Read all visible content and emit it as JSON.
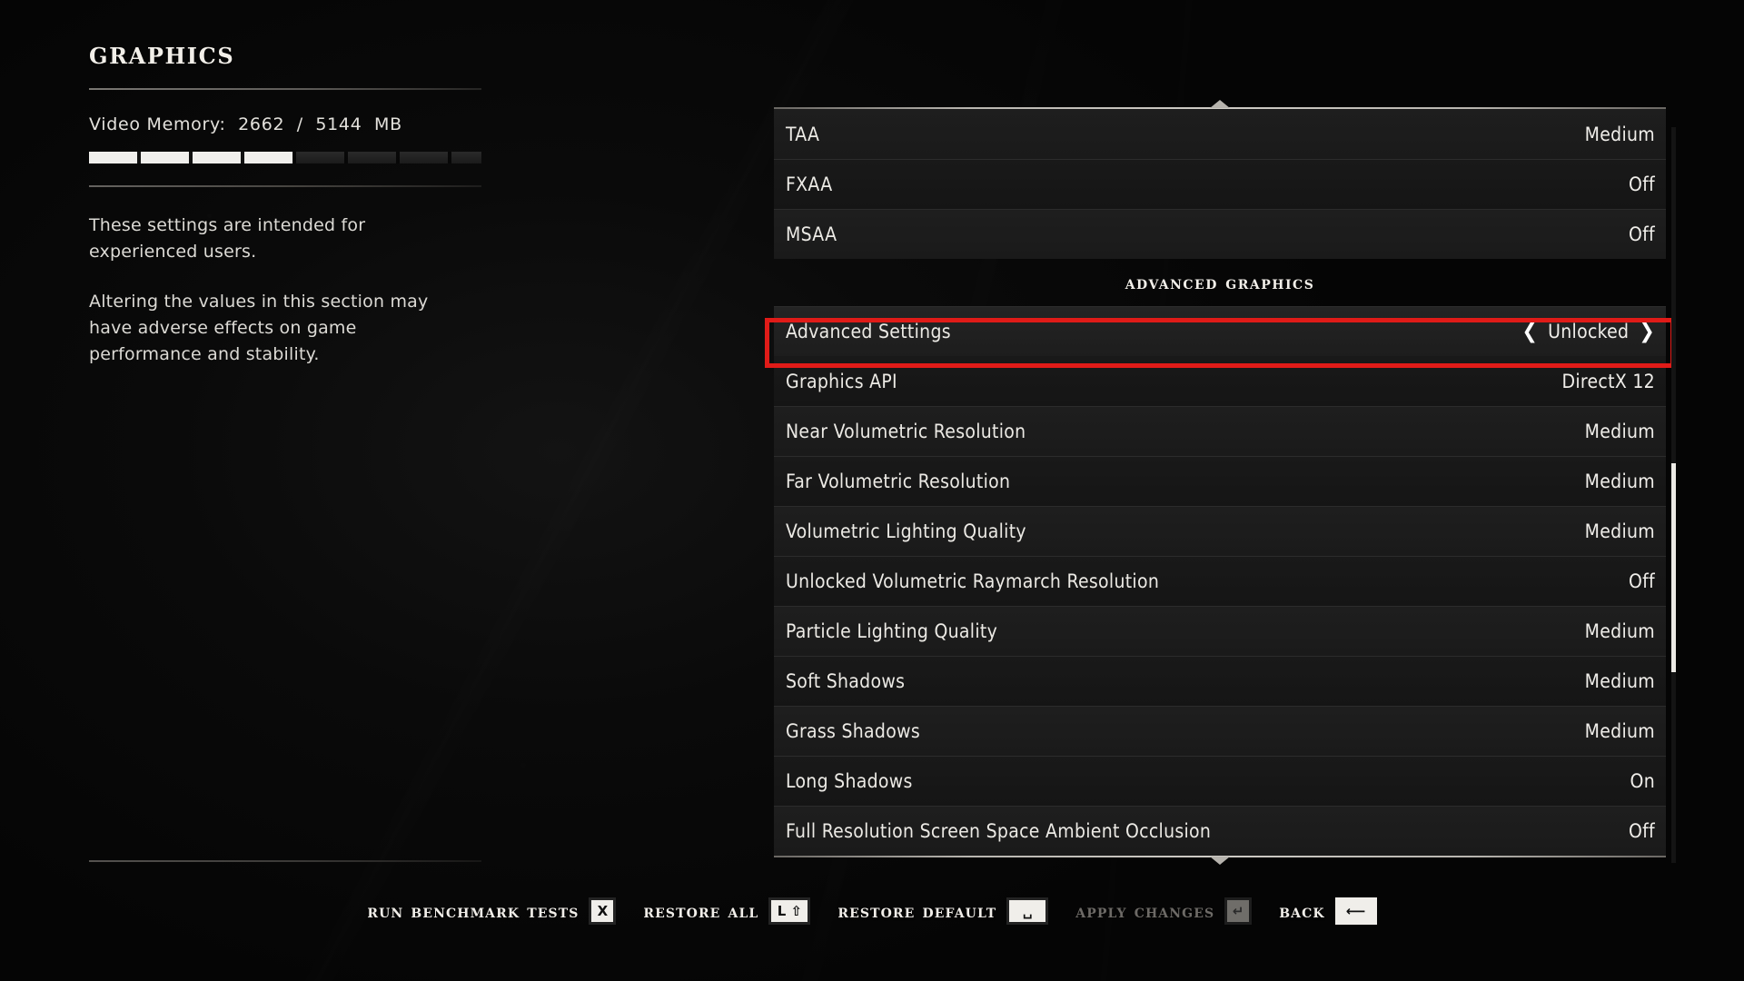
{
  "left_panel": {
    "title": "Graphics",
    "video_memory_label": "Video Memory:  2662  /  5144  MB",
    "video_memory_used": 2662,
    "video_memory_total": 5144,
    "video_memory_percent": 52,
    "description_1": "These settings are intended for experienced users.",
    "description_2": "Altering the values in this section may have adverse effects on game performance and stability."
  },
  "settings_panel": {
    "scroll_up_indicator": "chevron-up",
    "scroll_down_indicator": "chevron-down",
    "section_header": "Advanced Graphics",
    "selected_row": {
      "label": "Advanced Settings",
      "value": "Unlocked",
      "left_arrow": "❮",
      "right_arrow": "❯",
      "highlight_color": "#e01b18"
    },
    "rows_before_section": [
      {
        "label": "TAA",
        "value": "Medium"
      },
      {
        "label": "FXAA",
        "value": "Off"
      },
      {
        "label": "MSAA",
        "value": "Off"
      }
    ],
    "rows_after_section": [
      {
        "label": "Graphics API",
        "value": "DirectX 12"
      },
      {
        "label": "Near Volumetric Resolution",
        "value": "Medium"
      },
      {
        "label": "Far Volumetric Resolution",
        "value": "Medium"
      },
      {
        "label": "Volumetric Lighting Quality",
        "value": "Medium"
      },
      {
        "label": "Unlocked Volumetric Raymarch Resolution",
        "value": "Off"
      },
      {
        "label": "Particle Lighting Quality",
        "value": "Medium"
      },
      {
        "label": "Soft Shadows",
        "value": "Medium"
      },
      {
        "label": "Grass Shadows",
        "value": "Medium"
      },
      {
        "label": "Long Shadows",
        "value": "On"
      },
      {
        "label": "Full Resolution Screen Space Ambient Occlusion",
        "value": "Off"
      }
    ]
  },
  "actions": [
    {
      "label": "Run Benchmark Tests",
      "key": "X",
      "key_style": "normal",
      "disabled": false
    },
    {
      "label": "Restore All",
      "key": "L ⇧",
      "key_style": "wide",
      "disabled": false
    },
    {
      "label": "Restore Default",
      "key": "␣",
      "key_style": "wide",
      "disabled": false
    },
    {
      "label": "Apply Changes",
      "key": "↵",
      "key_style": "dim",
      "disabled": true
    },
    {
      "label": "Back",
      "key": "⟵",
      "key_style": "wide-plain",
      "disabled": false
    }
  ]
}
